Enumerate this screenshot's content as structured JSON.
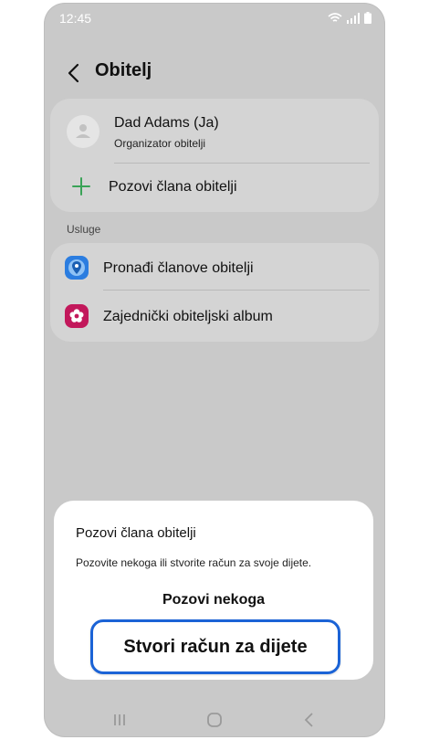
{
  "status_bar": {
    "time": "12:45"
  },
  "header": {
    "title": "Obitelj"
  },
  "family_card": {
    "member_name": "Dad Adams (Ja)",
    "member_role": "Organizator obitelji",
    "invite_label": "Pozovi člana obitelji"
  },
  "services": {
    "section_label": "Usluge",
    "items": [
      {
        "label": "Pronađi članove obitelji",
        "icon": "location-pin-icon",
        "color": "#2b7de0"
      },
      {
        "label": "Zajednički obiteljski album",
        "icon": "flower-album-icon",
        "color": "#c2185b"
      }
    ]
  },
  "dialog": {
    "title": "Pozovi člana obitelji",
    "description": "Pozovite nekoga ili stvorite račun za svoje dijete.",
    "invite_someone_label": "Pozovi nekoga",
    "create_child_account_label": "Stvori račun za dijete"
  },
  "colors": {
    "accent": "#1b63d6",
    "plus_green": "#3aa357",
    "overlay_bg": "#c9c9c9"
  }
}
